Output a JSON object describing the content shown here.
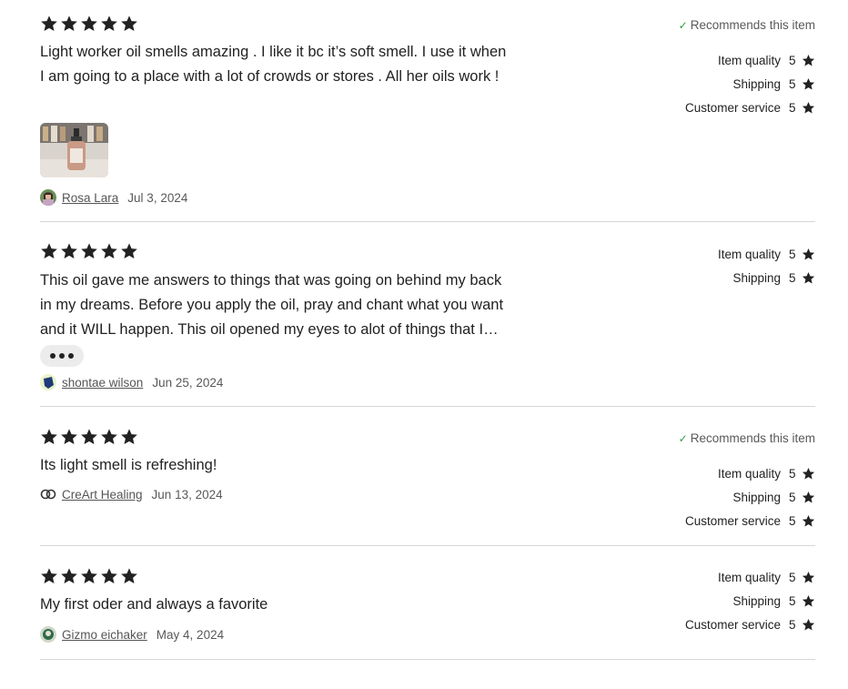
{
  "colors": {
    "text": "#222222",
    "muted": "#595959",
    "divider": "#d6d6d6",
    "check": "#2f9e44",
    "star": "#222222"
  },
  "reviews": [
    {
      "stars": 5,
      "text": "Light worker oil smells amazing . I like it bc it’s soft smell. I use it when I am going to a place with a lot of crowds or stores . All her oils work !",
      "has_photo": true,
      "reviewer": "Rosa Lara",
      "date": "Jul 3, 2024",
      "recommends": "Recommends this item",
      "ratings": [
        {
          "label": "Item quality",
          "value": "5"
        },
        {
          "label": "Shipping",
          "value": "5"
        },
        {
          "label": "Customer service",
          "value": "5"
        }
      ]
    },
    {
      "stars": 5,
      "text": "This oil gave me answers to things that was going on behind my back in my dreams. Before you apply the oil, pray and chant what you want and it WILL happen. This oil opened my eyes to alot of things that I didn't see before.",
      "truncated": true,
      "reviewer": "shontae wilson",
      "date": "Jun 25, 2024",
      "ratings": [
        {
          "label": "Item quality",
          "value": "5"
        },
        {
          "label": "Shipping",
          "value": "5"
        }
      ]
    },
    {
      "stars": 5,
      "text": "Its light smell is refreshing!",
      "reviewer": "CreArt Healing",
      "date": "Jun 13, 2024",
      "recommends": "Recommends this item",
      "ratings": [
        {
          "label": "Item quality",
          "value": "5"
        },
        {
          "label": "Shipping",
          "value": "5"
        },
        {
          "label": "Customer service",
          "value": "5"
        }
      ]
    },
    {
      "stars": 5,
      "text": "My first oder and always a favorite",
      "reviewer": "Gizmo eichaker",
      "date": "May 4, 2024",
      "ratings": [
        {
          "label": "Item quality",
          "value": "5"
        },
        {
          "label": "Shipping",
          "value": "5"
        },
        {
          "label": "Customer service",
          "value": "5"
        }
      ]
    }
  ]
}
